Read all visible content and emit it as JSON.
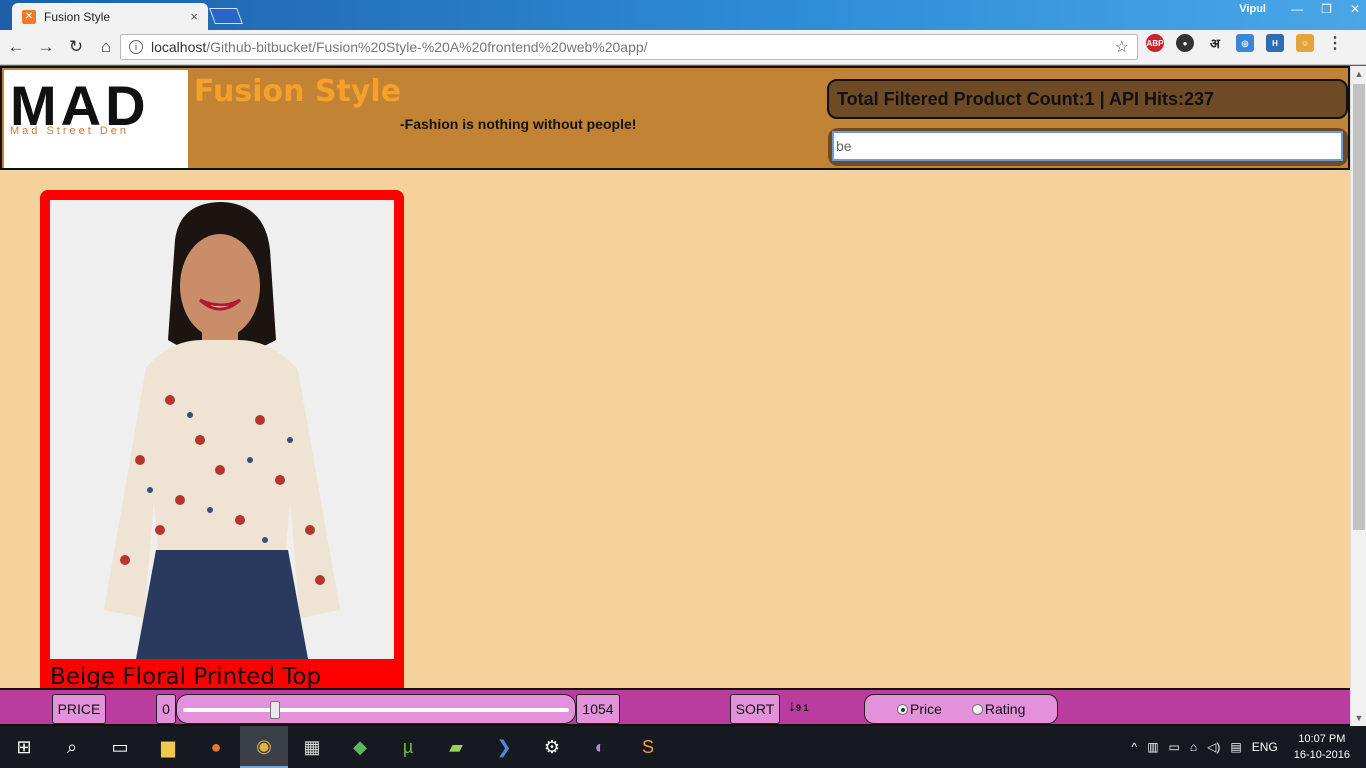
{
  "browser": {
    "tab_title": "Fusion Style",
    "tab_close": "×",
    "user": "Vipul",
    "url_host": "localhost",
    "url_path": "/Github-bitbucket/Fusion%20Style-%20A%20frontend%20web%20app/",
    "ext_abp": "ABP",
    "ext_hindi": "अ"
  },
  "header": {
    "logo_text": "MAD",
    "logo_subtext": "Mad Street Den",
    "title": "Fusion Style",
    "tagline": "-Fashion is nothing without people!",
    "stats_label": "Total Filtered Product Count:1 | API Hits:237",
    "search_value": "be"
  },
  "products": [
    {
      "name": "Beige Floral Printed Top"
    }
  ],
  "filters": {
    "price_label": "PRICE",
    "price_min": "0",
    "price_max": "1054",
    "slider_position": 0.23,
    "sort_label": "SORT",
    "sort_icon": "↓",
    "sort_digits": "9 1",
    "sort_options": [
      {
        "label": "Price",
        "selected": true
      },
      {
        "label": "Rating",
        "selected": false
      }
    ]
  },
  "taskbar": {
    "language": "ENG",
    "time": "10:07 PM",
    "date": "16-10-2016"
  }
}
